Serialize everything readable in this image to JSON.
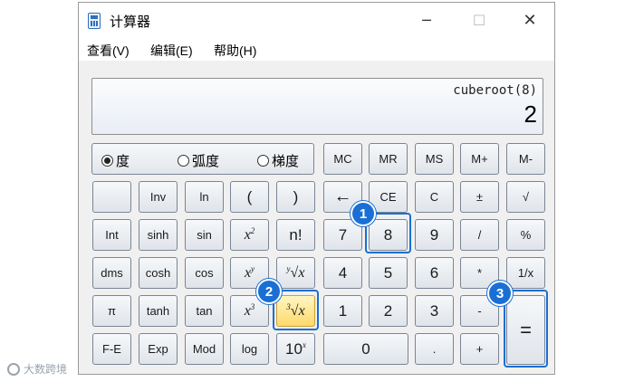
{
  "window": {
    "title": "计算器",
    "controls": {
      "minimize": "─",
      "maximize": "☐",
      "close": "✕"
    }
  },
  "menu": [
    "查看(V)",
    "编辑(E)",
    "帮助(H)"
  ],
  "display": {
    "expression": "cuberoot(8)",
    "value": "2"
  },
  "angle_modes": [
    {
      "label": "度",
      "selected": true
    },
    {
      "label": "弧度",
      "selected": false
    },
    {
      "label": "梯度",
      "selected": false
    }
  ],
  "buttons": {
    "memory": [
      "MC",
      "MR",
      "MS",
      "M+",
      "M-"
    ],
    "row2": [
      "",
      "Inv",
      "ln",
      "(",
      ")",
      "←",
      "CE",
      "C",
      "±",
      "√"
    ],
    "row3": [
      "Int",
      "sinh",
      "sin",
      "x",
      "n!",
      "7",
      "8",
      "9",
      "/",
      "%"
    ],
    "row3_sup": "2",
    "row4": [
      "dms",
      "cosh",
      "cos",
      "x",
      "√x",
      "4",
      "5",
      "6",
      "*",
      "1/x"
    ],
    "row4_sup": "y",
    "row4_yroot_index": "y",
    "row5": [
      "π",
      "tanh",
      "tan",
      "x",
      "√x",
      "1",
      "2",
      "3",
      "-",
      "="
    ],
    "row5_sup": "3",
    "row5_cuberoot_index": "3",
    "row6": [
      "F-E",
      "Exp",
      "Mod",
      "log",
      "10",
      "0",
      ".",
      "+"
    ],
    "row6_sup": "x"
  },
  "callouts": [
    "1",
    "2",
    "3"
  ],
  "watermark": "大数跨境",
  "colors": {
    "callout": "#1a6fd4",
    "highlight": "#ffd96a"
  }
}
